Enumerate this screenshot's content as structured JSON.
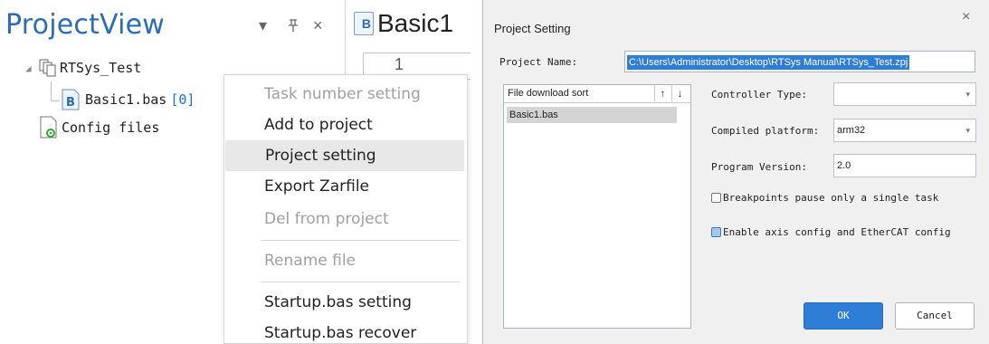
{
  "project_view": {
    "title": "ProjectView",
    "controls": {
      "dropdown": "▾",
      "pin": "ᵖ",
      "close": "×"
    },
    "tree": [
      {
        "label": "RTSys_Test",
        "level": 0
      },
      {
        "label": "Basic1.bas",
        "count": "[0]",
        "level": 1
      },
      {
        "label": "Config files",
        "level": 0
      }
    ],
    "tab": {
      "label": "Basic1",
      "icon_letter": "B"
    },
    "editor_line_number": "1"
  },
  "context_menu": {
    "items": [
      {
        "label": "Task number setting",
        "disabled": true
      },
      {
        "label": "Add to project",
        "disabled": false
      },
      {
        "label": "Project setting",
        "disabled": false,
        "highlighted": true
      },
      {
        "label": "Export Zarfile",
        "disabled": false
      },
      {
        "label": "Del from project",
        "disabled": true
      },
      {
        "label": "Rename file",
        "disabled": true
      },
      {
        "label": "Startup.bas setting",
        "disabled": false
      },
      {
        "label": "Startup.bas recover",
        "disabled": false
      }
    ]
  },
  "dialog": {
    "title": "Project Setting",
    "close": "×",
    "project_name_label": "Project Name:",
    "project_name_value": "C:\\Users\\Administrator\\Desktop\\RTSys Manual\\RTSys_Test.zpj",
    "file_sort": {
      "header": "File download sort",
      "up": "↑",
      "down": "↓",
      "items": [
        "Basic1.bas"
      ]
    },
    "controller_type_label": "Controller Type:",
    "controller_type_value": "",
    "compiled_platform_label": "Compiled platform:",
    "compiled_platform_value": "arm32",
    "program_version_label": "Program Version:",
    "program_version_value": "2.0",
    "checkbox_breakpoints": "Breakpoints pause only a single task",
    "checkbox_axis": "Enable axis config and EtherCAT config",
    "ok_label": "OK",
    "cancel_label": "Cancel"
  }
}
